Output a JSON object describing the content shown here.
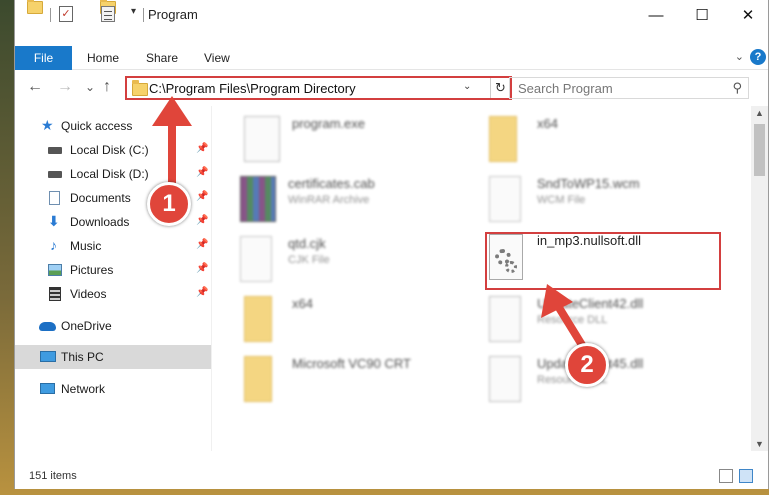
{
  "window": {
    "title": "Program"
  },
  "titlebar": {
    "minimize": "—",
    "maximize": "☐",
    "close": "✕"
  },
  "ribbon": {
    "tabs": [
      "File",
      "Home",
      "Share",
      "View"
    ]
  },
  "nav": {
    "back": "←",
    "forward": "→",
    "recent": "⌄",
    "up": "↑",
    "address": "C:\\Program Files\\Program Directory",
    "search_placeholder": "Search Program"
  },
  "sidebar": {
    "items": [
      {
        "label": "Quick access",
        "icon": "star-icon",
        "pinned": false
      },
      {
        "label": "Local Disk (C:)",
        "icon": "drive-icon",
        "pinned": true
      },
      {
        "label": "Local Disk (D:)",
        "icon": "drive-icon",
        "pinned": true
      },
      {
        "label": "Documents",
        "icon": "documents-icon",
        "pinned": true
      },
      {
        "label": "Downloads",
        "icon": "download-icon",
        "pinned": true
      },
      {
        "label": "Music",
        "icon": "music-icon",
        "pinned": true
      },
      {
        "label": "Pictures",
        "icon": "pictures-icon",
        "pinned": true
      },
      {
        "label": "Videos",
        "icon": "videos-icon",
        "pinned": true
      },
      {
        "label": "OneDrive",
        "icon": "cloud-icon",
        "pinned": false
      },
      {
        "label": "This PC",
        "icon": "computer-icon",
        "pinned": false,
        "selected": true
      },
      {
        "label": "Network",
        "icon": "network-icon",
        "pinned": false
      }
    ]
  },
  "files": [
    {
      "name": "program.exe",
      "type": "",
      "icon": "exe-icon"
    },
    {
      "name": "x64",
      "type": "",
      "icon": "folder-icon"
    },
    {
      "name": "certificates.cab",
      "type": "WinRAR Archive",
      "icon": "winrar-icon"
    },
    {
      "name": "SndToWP15.wcm",
      "type": "WCM File",
      "icon": "file-icon"
    },
    {
      "name": "qtd.cjk",
      "type": "CJK File",
      "icon": "file-icon"
    },
    {
      "name": "in_mp3.nullsoft.dll",
      "type": "",
      "icon": "dll-icon"
    },
    {
      "name": "x64",
      "type": "",
      "icon": "folder-icon"
    },
    {
      "name": "UpdateClient42.dll",
      "type": "Resource DLL",
      "icon": "dll-icon"
    },
    {
      "name": "Microsoft VC90 CRT",
      "type": "",
      "icon": "folder-icon"
    },
    {
      "name": "UpdateClient45.dll",
      "type": "Resource DLL",
      "icon": "dll-icon"
    }
  ],
  "status": {
    "item_count": "151 items"
  },
  "annotations": {
    "step1": "1",
    "step2": "2"
  },
  "colors": {
    "accent": "#1979ca",
    "highlight": "#d33f3f",
    "callout": "#e0453a"
  }
}
